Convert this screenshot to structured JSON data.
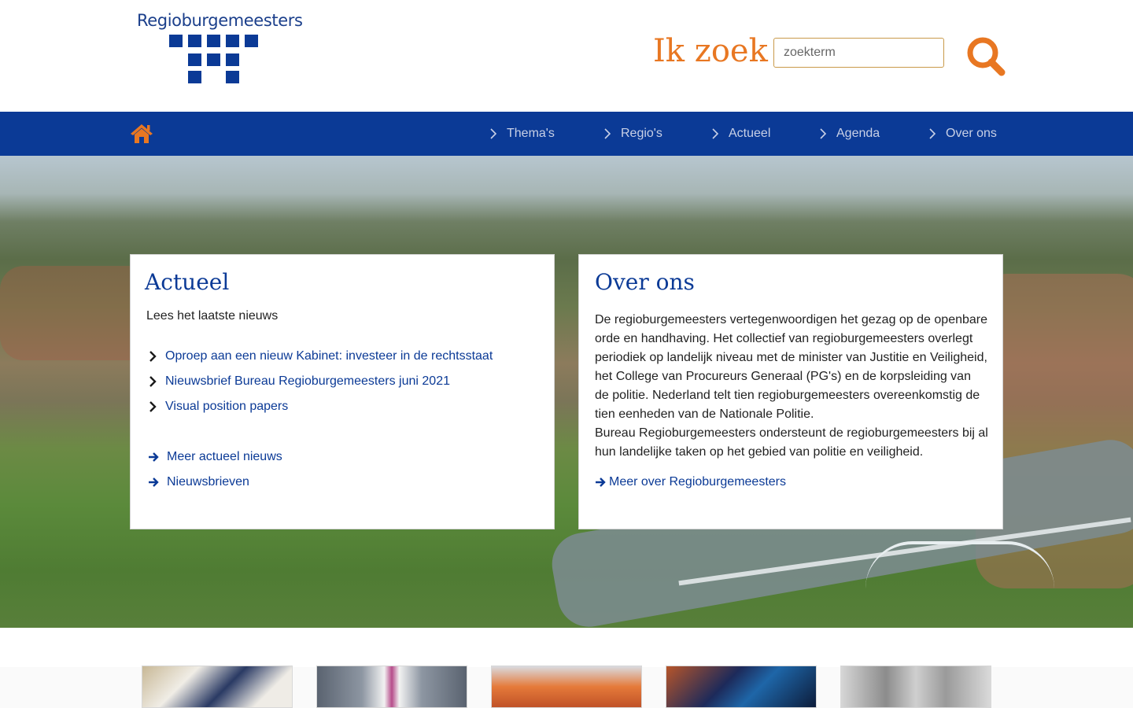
{
  "header": {
    "logo_text": "Regioburgemeesters",
    "search_heading": "Ik zoek",
    "search_placeholder": "zoekterm",
    "search_icon": "magnifier-icon",
    "accent_color": "#e87722"
  },
  "nav": {
    "home_icon": "home-icon",
    "items": [
      {
        "label": "Thema's"
      },
      {
        "label": "Regio's"
      },
      {
        "label": "Actueel"
      },
      {
        "label": "Agenda"
      },
      {
        "label": "Over ons"
      }
    ],
    "background_color": "#0b3a96"
  },
  "actueel": {
    "title": "Actueel",
    "subtitle": "Lees het laatste nieuws",
    "news": [
      {
        "label": "Oproep aan een nieuw Kabinet: investeer in de rechtsstaat"
      },
      {
        "label": "Nieuwsbrief Bureau Regioburgemeesters juni 2021"
      },
      {
        "label": "Visual position papers"
      }
    ],
    "more_links": [
      {
        "label": "Meer actueel nieuws"
      },
      {
        "label": "Nieuwsbrieven"
      }
    ]
  },
  "over_ons": {
    "title": "Over ons",
    "paragraph_1": "De regioburgemeesters vertegenwoordigen het gezag op de openbare orde en handhaving. Het collectief van regioburgemeesters overlegt periodiek op landelijk niveau met de minister van Justitie en Veiligheid, het College van Procureurs Generaal (PG's) en de korpsleiding van de politie. Nederland telt tien regioburgemeesters overeenkomstig de tien eenheden van de Nationale Politie.",
    "paragraph_2": "Bureau Regioburgemeesters ondersteunt de regioburgemeesters bij al hun landelijke taken op het gebied van politie en veiligheid.",
    "more_link": "Meer over Regioburgemeesters"
  }
}
